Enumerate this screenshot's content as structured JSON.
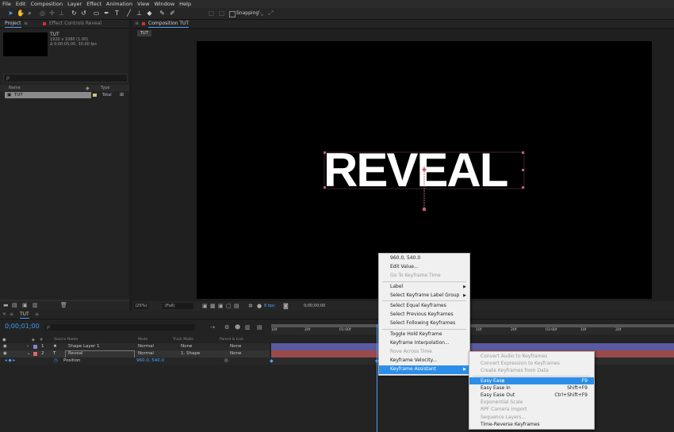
{
  "menubar": {
    "items": [
      "File",
      "Edit",
      "Composition",
      "Layer",
      "Effect",
      "Animation",
      "View",
      "Window",
      "Help"
    ]
  },
  "toolbar": {
    "snapping_label": "Snapping"
  },
  "project_panel": {
    "tab_label": "Project",
    "effect_controls_label": "Effect Controls Reveal",
    "item_name": "TUT",
    "item_info_1": "1920 x 1080 (1.00)",
    "item_info_2": "Δ 0;00;05;00, 30.00 fps",
    "search_placeholder": "ρ",
    "col_name": "Name",
    "col_type": "Type",
    "row_name": "TUT",
    "row_type": "Total"
  },
  "comp_panel": {
    "tab_label": "Composition TUT",
    "breadcrumb": "TUT",
    "title_text": "REVEAL",
    "zoom": "(25%)",
    "resolution": "(Full)",
    "timecode": "0;00;00;00",
    "bits": "8 bpc"
  },
  "timeline": {
    "tab_label": "TUT",
    "timecode": "0;00;01;00",
    "col_source": "Source Name",
    "col_mode": "Mode",
    "col_trkmat": "Track Matte",
    "col_parent": "Parent & Link",
    "layers": [
      {
        "num": "1",
        "name": "Shape Layer 1",
        "mode": "Normal",
        "matte": "None",
        "parent": "None",
        "color": "#8d7ed8"
      },
      {
        "num": "2",
        "name": "Reveal",
        "mode": "Normal",
        "matte": "1. Shape",
        "parent": "None",
        "color": "#d86b6b"
      }
    ],
    "property_name": "Position",
    "property_value": "960.0, 540.0",
    "ruler_ticks": [
      "10f",
      "20f",
      "01:00f",
      "10f",
      "20f",
      "02:00f",
      "10f",
      "20f",
      "03:00f",
      "10f",
      "20f"
    ]
  },
  "context_menu": {
    "items": [
      {
        "label": "960.0, 540.0",
        "disabled": false
      },
      {
        "label": "Edit Value...",
        "disabled": false
      },
      {
        "label": "Go To Keyframe Time",
        "disabled": true
      },
      {
        "sep": true
      },
      {
        "label": "Label",
        "disabled": false,
        "submenu": true
      },
      {
        "label": "Select Keyframe Label Group",
        "disabled": false,
        "submenu": true
      },
      {
        "sep": true
      },
      {
        "label": "Select Equal Keyframes",
        "disabled": false
      },
      {
        "label": "Select Previous Keyframes",
        "disabled": false
      },
      {
        "label": "Select Following Keyframes",
        "disabled": false
      },
      {
        "sep": true
      },
      {
        "label": "Toggle Hold Keyframe",
        "disabled": false
      },
      {
        "label": "Keyframe Interpolation...",
        "disabled": false
      },
      {
        "label": "Rove Across Time",
        "disabled": true
      },
      {
        "label": "Keyframe Velocity...",
        "disabled": false
      },
      {
        "label": "Keyframe Assistant",
        "disabled": false,
        "submenu": true,
        "highlight": true
      }
    ]
  },
  "submenu": {
    "items": [
      {
        "label": "Convert Audio to Keyframes",
        "disabled": true,
        "shortcut": ""
      },
      {
        "label": "Convert Expression to Keyframes",
        "disabled": true,
        "shortcut": ""
      },
      {
        "label": "Create Keyframes from Data",
        "disabled": true,
        "shortcut": ""
      },
      {
        "label": "Easy Ease",
        "disabled": false,
        "shortcut": "F9",
        "highlight": true
      },
      {
        "label": "Easy Ease In",
        "disabled": false,
        "shortcut": "Shift+F9"
      },
      {
        "label": "Easy Ease Out",
        "disabled": false,
        "shortcut": "Ctrl+Shift+F9"
      },
      {
        "label": "Exponential Scale",
        "disabled": true,
        "shortcut": ""
      },
      {
        "label": "RPF Camera Import",
        "disabled": true,
        "shortcut": ""
      },
      {
        "label": "Sequence Layers...",
        "disabled": true,
        "shortcut": ""
      },
      {
        "label": "Time-Reverse Keyframes",
        "disabled": false,
        "shortcut": ""
      }
    ]
  },
  "colors": {
    "accent": "#2d8ee8",
    "timecode": "#3a9df0"
  }
}
